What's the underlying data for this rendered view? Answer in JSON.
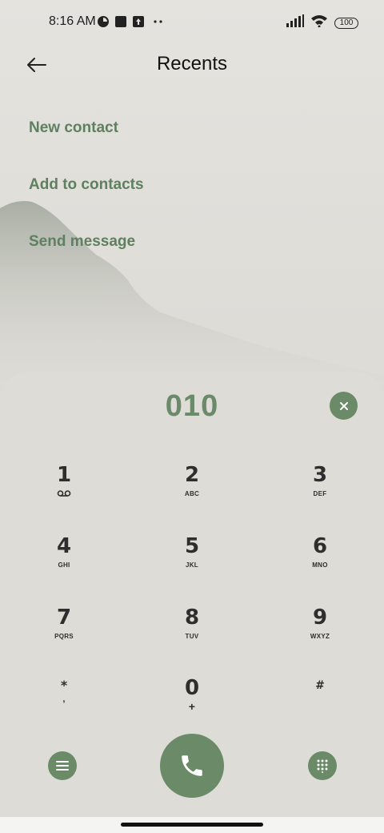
{
  "status": {
    "time": "8:16 AM",
    "battery": "100",
    "icons": [
      "app-badge-icon",
      "square-notification-icon",
      "upload-icon",
      "more-dots-icon",
      "signal-icon",
      "wifi-icon",
      "battery-icon"
    ]
  },
  "header": {
    "title": "Recents",
    "back_icon": "arrow-left-icon"
  },
  "actions": {
    "new_contact": "New contact",
    "add_to_contacts": "Add to contacts",
    "send_message": "Send message"
  },
  "dialer": {
    "number": "010",
    "keys": [
      {
        "digit": "1",
        "letters": ""
      },
      {
        "digit": "2",
        "letters": "ABC"
      },
      {
        "digit": "3",
        "letters": "DEF"
      },
      {
        "digit": "4",
        "letters": "GHI"
      },
      {
        "digit": "5",
        "letters": "JKL"
      },
      {
        "digit": "6",
        "letters": "MNO"
      },
      {
        "digit": "7",
        "letters": "PQRS"
      },
      {
        "digit": "8",
        "letters": "TUV"
      },
      {
        "digit": "9",
        "letters": "WXYZ"
      },
      {
        "digit": "*",
        "letters": ","
      },
      {
        "digit": "0",
        "letters": "+"
      },
      {
        "digit": "#",
        "letters": ""
      }
    ]
  },
  "colors": {
    "accent": "#6a8a68",
    "accent_text": "#5e8060",
    "background": "#dcdbd6"
  }
}
